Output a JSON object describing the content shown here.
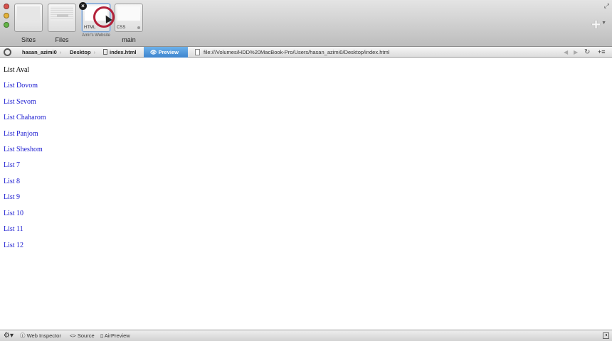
{
  "tabs": {
    "sites_label": "Sites",
    "files_label": "Files",
    "html_tag": "HTML",
    "html_sub": "Amir's Website",
    "css_tag": "CSS",
    "main_label": "main",
    "close_glyph": "×",
    "add_glyph": "+"
  },
  "breadcrumb": {
    "user": "hasan_azimi0",
    "desktop": "Desktop",
    "file": "index.html",
    "preview": "Preview"
  },
  "address": {
    "url": "file:///Volumes/HDD%20MacBook-Pro/Users/hasan_azimi0/Desktop/index.html"
  },
  "content": {
    "items": [
      {
        "label": "List Aval",
        "link": false
      },
      {
        "label": "List Dovom",
        "link": true
      },
      {
        "label": "List Sevom",
        "link": true
      },
      {
        "label": "List Chaharom",
        "link": true
      },
      {
        "label": "List Panjom",
        "link": true
      },
      {
        "label": "List Sheshom",
        "link": true
      },
      {
        "label": "List 7",
        "link": true
      },
      {
        "label": "List 8",
        "link": true
      },
      {
        "label": "List 9",
        "link": true
      },
      {
        "label": "List 10",
        "link": true
      },
      {
        "label": "List 11",
        "link": true
      },
      {
        "label": "List 12",
        "link": true
      }
    ]
  },
  "statusbar": {
    "inspector": "Web Inspector",
    "source": "Source",
    "airpreview": "AirPreview"
  },
  "colors": {
    "link": "#1a1ad0",
    "preview_tab": "#3d84cd",
    "cursor_ring": "#b3213a"
  }
}
